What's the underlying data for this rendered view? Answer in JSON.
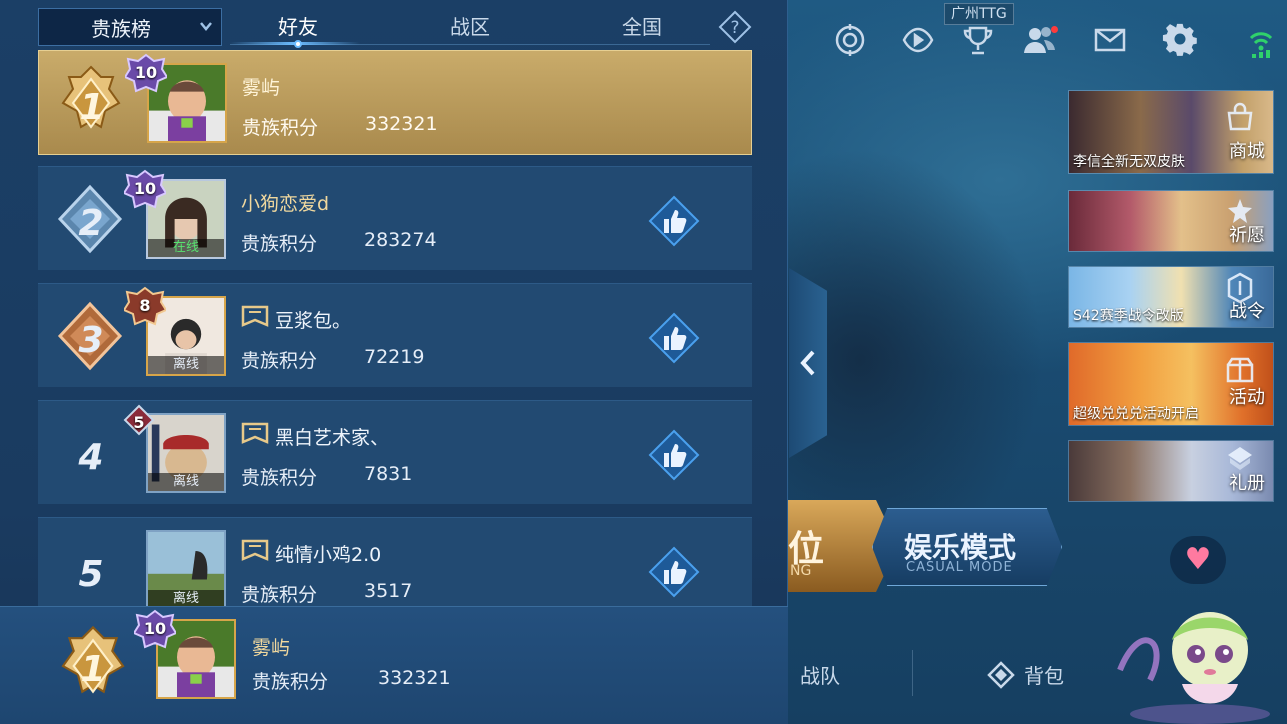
{
  "panel": {
    "dropdown_label": "贵族榜",
    "tabs": [
      {
        "label": "好友",
        "active": true
      },
      {
        "label": "战区",
        "active": false
      },
      {
        "label": "全国",
        "active": false
      }
    ],
    "help_icon": "question-diamond-icon"
  },
  "leaderboard": [
    {
      "rank": "1",
      "name": "雾屿",
      "level": "10",
      "score_label": "贵族积分",
      "score": "332321",
      "status": "",
      "has_flag": false
    },
    {
      "rank": "2",
      "name": "小狗恋爱d",
      "level": "10",
      "score_label": "贵族积分",
      "score": "283274",
      "status": "在线",
      "has_flag": false
    },
    {
      "rank": "3",
      "name": "豆浆包。",
      "level": "8",
      "score_label": "贵族积分",
      "score": "72219",
      "status": "离线",
      "has_flag": true
    },
    {
      "rank": "4",
      "name": "黑白艺术家、",
      "level": "5",
      "score_label": "贵族积分",
      "score": "7831",
      "status": "离线",
      "has_flag": true
    },
    {
      "rank": "5",
      "name": "纯情小鸡2.0",
      "level": "",
      "score_label": "贵族积分",
      "score": "3517",
      "status": "离线",
      "has_flag": true
    }
  ],
  "my_rank": {
    "rank": "1",
    "name": "雾屿",
    "level": "10",
    "score_label": "贵族积分",
    "score": "332321"
  },
  "top_bar": {
    "server_tag": "广州TTG",
    "icons": [
      "target-icon",
      "replay-icon",
      "trophy-icon",
      "friends-icon",
      "mail-icon",
      "gear-icon",
      "wifi-icon"
    ]
  },
  "side_cards": [
    {
      "label": "商城",
      "subtitle": "李信全新无双皮肤",
      "icon": "shop-icon"
    },
    {
      "label": "祈愿",
      "subtitle": "",
      "icon": "wish-icon"
    },
    {
      "label": "战令",
      "subtitle": "S42赛季战令改版",
      "icon": "battlepass-icon"
    },
    {
      "label": "活动",
      "subtitle": "超级兑兑兑活动开启",
      "icon": "gift-chest-icon"
    },
    {
      "label": "礼册",
      "subtitle": "",
      "icon": "gift-book-icon"
    }
  ],
  "modes": {
    "rank_text": "位",
    "rank_en": "NG",
    "casual_text": "娱乐模式",
    "casual_en": "CASUAL MODE"
  },
  "bottom_nav": [
    {
      "label": "战队"
    },
    {
      "label": "背包"
    }
  ],
  "colors": {
    "panel_bg": "#1b3f66",
    "row_bg": "#224a72",
    "top_row_gold": "#c9ab6a",
    "name_gold": "#f0d89e",
    "online_green": "#58e36f",
    "like_blue": "#2f7fd0"
  }
}
